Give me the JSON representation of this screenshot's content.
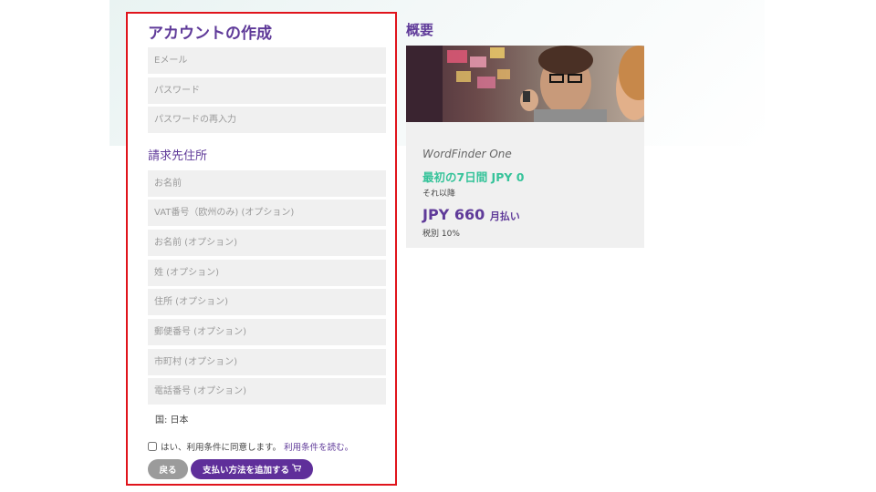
{
  "form": {
    "title": "アカウントの作成",
    "email_placeholder": "Eメール",
    "password_placeholder": "パスワード",
    "password_confirm_placeholder": "パスワードの再入力",
    "billing_title": "請求先住所",
    "billing_fields": {
      "name": "お名前",
      "vat": "VAT番号（欧州のみ) (オプション)",
      "first_name": "お名前 (オプション)",
      "last_name": "姓 (オプション)",
      "address": "住所 (オプション)",
      "postal": "郵便番号 (オプション)",
      "city": "市町村 (オプション)",
      "phone": "電話番号 (オプション)"
    },
    "country": "国: 日本",
    "terms_text": "はい、利用条件に同意します。",
    "terms_link": "利用条件を読む。",
    "back_button": "戻る",
    "pay_button": "支払い方法を追加する"
  },
  "summary": {
    "title": "概要",
    "product": "WordFinder One",
    "trial": "最初の7日間 JPY 0",
    "after": "それ以降",
    "price": "JPY 660",
    "price_unit": "月払い",
    "tax": "税別 10%"
  },
  "colors": {
    "accent": "#5f3a99",
    "trial_green": "#36c39a",
    "highlight_border": "#e0141c"
  },
  "icons": {
    "cart": "shopping-cart-icon"
  }
}
